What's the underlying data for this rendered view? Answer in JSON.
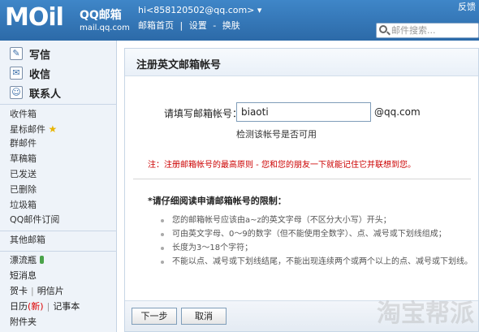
{
  "header": {
    "logo": "MOil",
    "brand_cn": "QQ邮箱",
    "brand_url": "mail.qq.com",
    "account_email": "hi<858120502@qq.com>",
    "account_caret": "▾",
    "links": [
      "邮箱首页",
      "|",
      "设置",
      "-",
      "换肤"
    ],
    "top_right": "反馈",
    "search_placeholder": "邮件搜索..."
  },
  "sidebar": {
    "actions": [
      {
        "label": "写信",
        "icon": "write-icon"
      },
      {
        "label": "收信",
        "icon": "inbox-icon"
      },
      {
        "label": "联系人",
        "icon": "contacts-icon"
      }
    ],
    "folders": [
      "收件箱",
      "星标邮件",
      "群邮件",
      "草稿箱",
      "已发送",
      "已删除",
      "垃圾箱",
      "QQ邮件订阅"
    ],
    "other_title": "其他邮箱",
    "extras": {
      "bottle": "漂流瓶",
      "sms": "短消息",
      "card": "贺卡",
      "postcard": "明信片",
      "calendar": "日历",
      "calendar_badge": "(新)",
      "notes": "记事本",
      "attach": "附件夹"
    }
  },
  "main": {
    "title": "注册英文邮箱帐号",
    "field_label": "请填写邮箱帐号：",
    "field_value": "biaoti",
    "suffix": "@qq.com",
    "check_link": "检测该帐号是否可用",
    "warning": "注：注册邮箱帐号的最高原则 - 您和您的朋友一下就能记住它并联想到您。",
    "rules_title": "*请仔细阅读申请邮箱帐号的限制：",
    "rules": [
      "您的邮箱帐号应该由a~z的英文字母（不区分大小写）开头；",
      "可由英文字母、0～9的数字（但不能使用全数字）、点、减号或下划线组成；",
      "长度为3～18个字符；",
      "不能以点、减号或下划线结尾，不能出现连续两个或两个以上的点、减号或下划线。"
    ],
    "next_button": "下一步",
    "cancel_button": "取消"
  },
  "watermark": "淘宝帮派"
}
